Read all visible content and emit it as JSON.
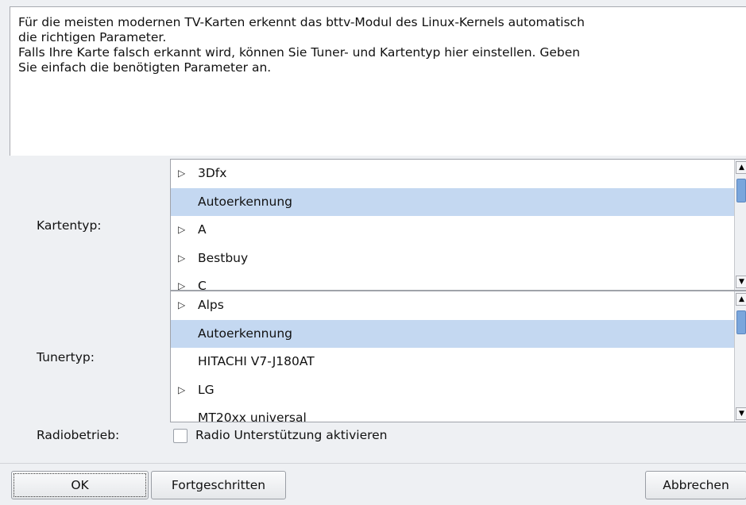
{
  "description": "Für die meisten modernen TV-Karten erkennt das bttv-Modul des Linux-Kernels automatisch\ndie richtigen Parameter.\nFalls Ihre Karte falsch erkannt wird, können Sie Tuner- und Kartentyp hier einstellen. Geben\nSie einfach die benötigten Parameter an.",
  "card_type": {
    "label": "Kartentyp:",
    "items": [
      {
        "text": "3Dfx",
        "expandable": true
      },
      {
        "text": "Autoerkennung",
        "expandable": false,
        "selected": true
      },
      {
        "text": "A",
        "expandable": true
      },
      {
        "text": "Bestbuy",
        "expandable": true
      },
      {
        "text": "C",
        "expandable": true
      }
    ]
  },
  "tuner_type": {
    "label": "Tunertyp:",
    "items": [
      {
        "text": "Alps",
        "expandable": true
      },
      {
        "text": "Autoerkennung",
        "expandable": false,
        "selected": true
      },
      {
        "text": "HITACHI V7-J180AT",
        "expandable": false
      },
      {
        "text": "LG",
        "expandable": true
      },
      {
        "text": "MT20xx universal",
        "expandable": false
      }
    ]
  },
  "radio": {
    "label": "Radiobetrieb:",
    "checkbox_label": "Radio Unterstützung aktivieren",
    "checked": false
  },
  "buttons": {
    "ok": "OK",
    "advanced": "Fortgeschritten",
    "cancel": "Abbrechen"
  },
  "icons": {
    "expand": "expand-triangle-icon",
    "scroll_up": "scroll-up-arrow-icon",
    "scroll_down": "scroll-down-arrow-icon"
  },
  "colors": {
    "selection": "#c4d8f1",
    "scroll_thumb": "#7aa6dc"
  }
}
